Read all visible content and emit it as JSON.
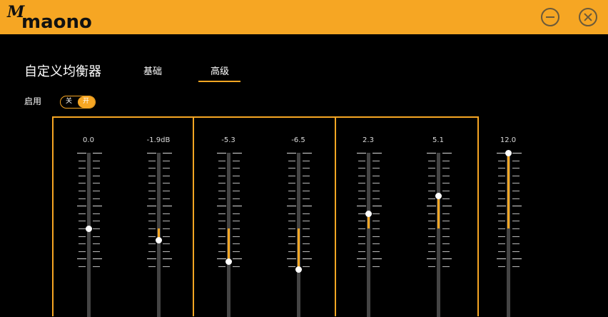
{
  "brand": {
    "logo_mark": "M",
    "logo_text": "maono"
  },
  "colors": {
    "accent": "#f6a623",
    "background": "#000000",
    "track": "#444444"
  },
  "window": {
    "minimize_icon": "minimize-circle-icon",
    "close_icon": "close-circle-icon"
  },
  "page_title": "自定义均衡器",
  "tabs": [
    {
      "label": "基础",
      "active": false
    },
    {
      "label": "高级",
      "active": true
    }
  ],
  "enable": {
    "label": "启用",
    "off_label": "关",
    "on_label": "开",
    "state": "on"
  },
  "eq_range_db": [
    -12,
    12
  ],
  "bands": [
    {
      "label": "0.0",
      "value": 0.0
    },
    {
      "label": "-1.9dB",
      "value": -1.9
    },
    {
      "label": "-5.3",
      "value": -5.3
    },
    {
      "label": "-6.5",
      "value": -6.5
    },
    {
      "label": "2.3",
      "value": 2.3
    },
    {
      "label": "5.1",
      "value": 5.1
    },
    {
      "label": "12.0",
      "value": 12.0
    }
  ]
}
